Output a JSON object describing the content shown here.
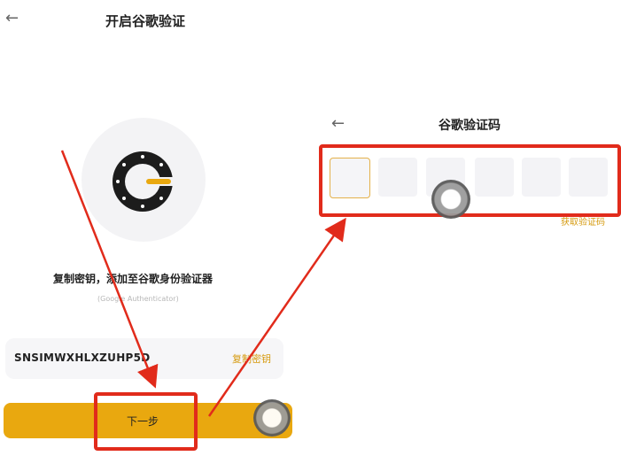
{
  "left_screen": {
    "back_icon": "arrow-left-icon",
    "title": "开启谷歌验证",
    "logo_icon": "google-authenticator-icon",
    "instruction": "复制密钥，添加至谷歌身份验证器",
    "subtitle": "(Google Authenticator)",
    "secret_key": "SNSIMWXHLXZUHP5D",
    "copy_key_label": "复制密钥",
    "next_button_label": "下一步"
  },
  "right_screen": {
    "back_icon": "arrow-left-icon",
    "title": "谷歌验证码",
    "code_digits": [
      "",
      "",
      "",
      "",
      "",
      ""
    ],
    "get_code_label": "获取验证码"
  },
  "colors": {
    "accent": "#e9a80f",
    "accent_text": "#d69b10",
    "annotation_red": "#e12b1b",
    "logo_dark": "#1c1c1c"
  }
}
